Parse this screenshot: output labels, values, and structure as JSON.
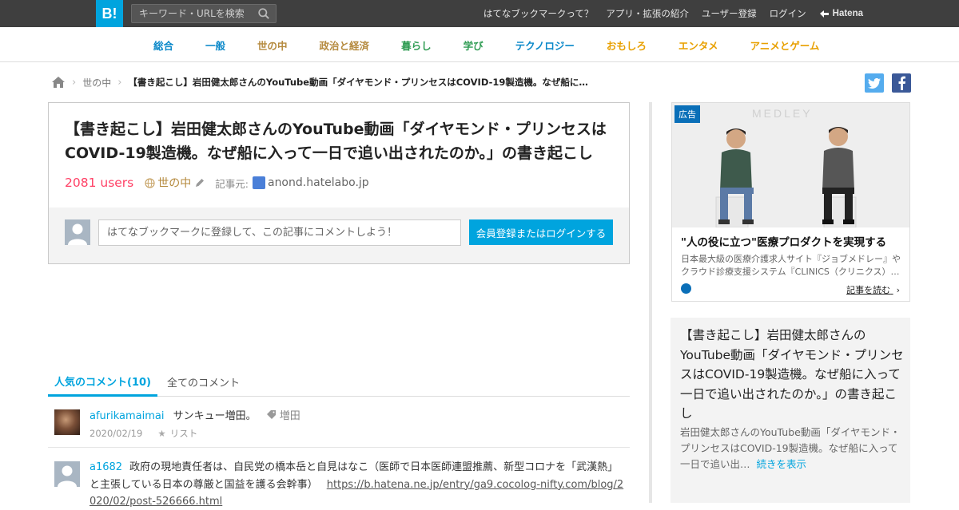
{
  "header": {
    "logo": "B!",
    "search_placeholder": "キーワード・URLを検索",
    "nav": [
      "はてなブックマークって？",
      "アプリ・拡張の紹介",
      "ユーザー登録",
      "ログイン"
    ],
    "brand": "Hatena"
  },
  "categories": [
    {
      "label": "総合",
      "color": "#0a88c9"
    },
    {
      "label": "一般",
      "color": "#0a88c9"
    },
    {
      "label": "世の中",
      "color": "#b58a3e"
    },
    {
      "label": "政治と経済",
      "color": "#b58a3e"
    },
    {
      "label": "暮らし",
      "color": "#2f9c53"
    },
    {
      "label": "学び",
      "color": "#2f9c53"
    },
    {
      "label": "テクノロジー",
      "color": "#0a88c9"
    },
    {
      "label": "おもしろ",
      "color": "#e8a000"
    },
    {
      "label": "エンタメ",
      "color": "#e8a000"
    },
    {
      "label": "アニメとゲーム",
      "color": "#e8a000"
    }
  ],
  "breadcrumb": {
    "category": "世の中",
    "current": "【書き起こし】岩田健太郎さんのYouTube動画「ダイヤモンド・プリンセスはCOVID-19製造機。なぜ船に…"
  },
  "entry": {
    "title": "【書き起こし】岩田健太郎さんのYouTube動画「ダイヤモンド・プリンセスはCOVID-19製造機。なぜ船に入って一日で追い出されたのか。」の書き起こし",
    "users": "2081 users",
    "category": "世の中",
    "source_label": "記事元:",
    "source": "anond.hatelabo.jp",
    "comment_placeholder": "はてなブックマークに登録して、この記事にコメントしよう！",
    "login_button": "会員登録またはログインする"
  },
  "tabs": {
    "popular": "人気のコメント(10)",
    "all": "全てのコメント"
  },
  "comments": [
    {
      "user": "afurikamaimai",
      "text": "サンキュー増田。",
      "tag": "増田",
      "date": "2020/02/19",
      "list": "リスト"
    },
    {
      "user": "a1682",
      "text": "政府の現地責任者は、自民党の橋本岳と自見はなこ（医師で日本医師連盟推薦、新型コロナを「武漢熱」と主張している日本の尊厳と国益を護る会幹事）",
      "url": "https://b.hatena.ne.jp/entry/ga9.cocolog-nifty.com/blog/2020/02/post-526666.html"
    }
  ],
  "ad": {
    "badge": "広告",
    "title": "\"人の役に立つ\"医療プロダクトを実現する",
    "desc": "日本最大級の医療介護求人サイト『ジョブメドレー』やクラウド診療支援システム『CLINICS（クリニクス）…",
    "more": "記事を読む",
    "logo_text": "MEDLEY"
  },
  "summary": {
    "title": "【書き起こし】岩田健太郎さんのYouTube動画「ダイヤモンド・プリンセスはCOVID-19製造機。なぜ船に入って一日で追い出されたのか。」の書き起こし",
    "text": "岩田健太郎さんのYouTube動画「ダイヤモンド・プリンセスはCOVID-19製造機。なぜ船に入って一日で追い出…",
    "more": "続きを表示"
  },
  "colors": {
    "accent": "#00a4de",
    "users": "#ff4166",
    "topbar": "#3f3f3f"
  }
}
